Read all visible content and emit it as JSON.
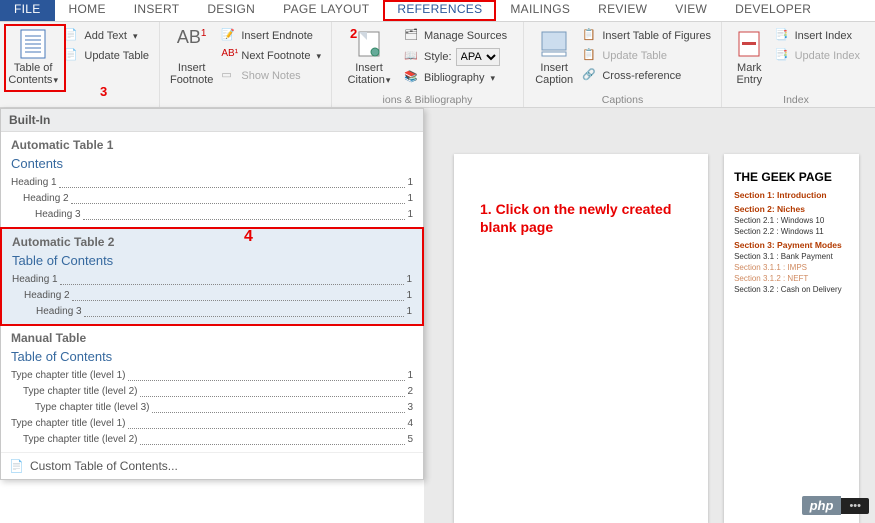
{
  "tabs": {
    "file": "FILE",
    "items": [
      "HOME",
      "INSERT",
      "DESIGN",
      "PAGE LAYOUT",
      "REFERENCES",
      "MAILINGS",
      "REVIEW",
      "VIEW",
      "DEVELOPER"
    ],
    "active_index": 4
  },
  "ribbon": {
    "toc": {
      "button": "Table of\nContents",
      "add_text": "Add Text",
      "update": "Update Table"
    },
    "footnotes": {
      "insert": "Insert\nFootnote",
      "endnote": "Insert Endnote",
      "next": "Next Footnote",
      "show": "Show Notes",
      "ab": "AB",
      "sup": "1"
    },
    "citations": {
      "insert": "Insert\nCitation",
      "manage": "Manage Sources",
      "style_label": "Style:",
      "style_value": "APA",
      "bib": "Bibliography",
      "group": "ions & Bibliography"
    },
    "captions": {
      "insert": "Insert\nCaption",
      "tof": "Insert Table of Figures",
      "update": "Update Table",
      "cross": "Cross-reference",
      "group": "Captions"
    },
    "index": {
      "mark": "Mark\nEntry",
      "insert": "Insert Index",
      "update": "Update Index",
      "group": "Index"
    }
  },
  "annotations": {
    "a1": "1. Click on the newly created blank page",
    "a2": "2",
    "a3": "3",
    "a4": "4"
  },
  "dropdown": {
    "builtin": "Built-In",
    "auto1": {
      "name": "Automatic Table 1",
      "title": "Contents",
      "rows": [
        {
          "label": "Heading 1",
          "page": "1",
          "level": 1
        },
        {
          "label": "Heading 2",
          "page": "1",
          "level": 2
        },
        {
          "label": "Heading 3",
          "page": "1",
          "level": 3
        }
      ]
    },
    "auto2": {
      "name": "Automatic Table 2",
      "title": "Table of Contents",
      "rows": [
        {
          "label": "Heading 1",
          "page": "1",
          "level": 1
        },
        {
          "label": "Heading 2",
          "page": "1",
          "level": 2
        },
        {
          "label": "Heading 3",
          "page": "1",
          "level": 3
        }
      ]
    },
    "manual": {
      "name": "Manual Table",
      "title": "Table of Contents",
      "rows": [
        {
          "label": "Type chapter title (level 1)",
          "page": "1",
          "level": 1
        },
        {
          "label": "Type chapter title (level 2)",
          "page": "2",
          "level": 2
        },
        {
          "label": "Type chapter title (level 3)",
          "page": "3",
          "level": 3
        },
        {
          "label": "Type chapter title (level 1)",
          "page": "4",
          "level": 1
        },
        {
          "label": "Type chapter title (level 2)",
          "page": "5",
          "level": 2
        }
      ]
    },
    "custom": "Custom Table of Contents..."
  },
  "doc_preview": {
    "title": "THE GEEK PAGE",
    "sections": [
      {
        "heading": "Section 1: Introduction",
        "items": []
      },
      {
        "heading": "Section 2: Niches",
        "items": [
          {
            "text": "Section 2.1 : Windows 10",
            "light": false
          },
          {
            "text": "Section 2.2 : Windows 11",
            "light": false
          }
        ]
      },
      {
        "heading": "Section 3: Payment Modes",
        "items": [
          {
            "text": "Section 3.1 : Bank Payment",
            "light": false
          },
          {
            "text": "Section 3.1.1 : IMPS",
            "light": true
          },
          {
            "text": "Section 3.1.2 : NEFT",
            "light": true
          },
          {
            "text": "Section 3.2 : Cash on Delivery",
            "light": false
          }
        ]
      }
    ]
  },
  "watermark": {
    "a": "php",
    "b": "•••"
  }
}
